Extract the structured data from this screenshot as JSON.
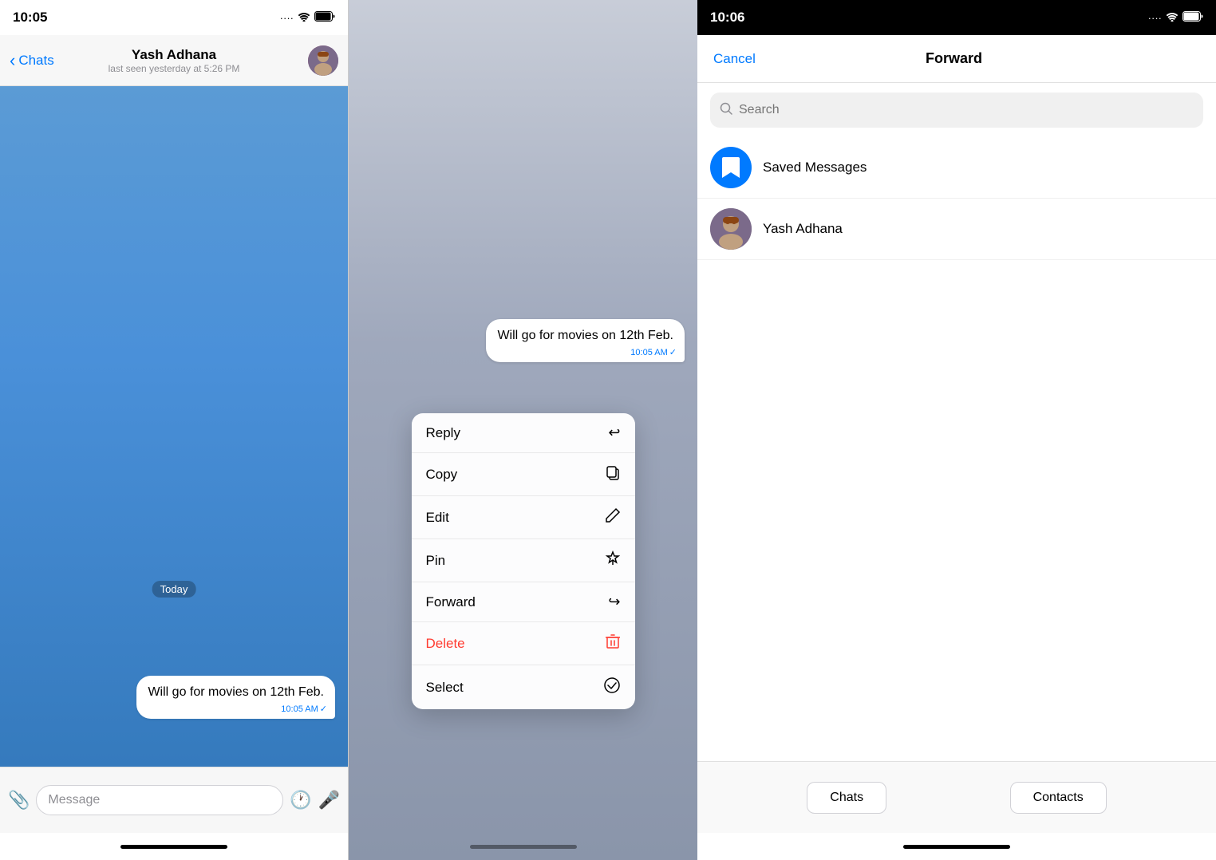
{
  "panel1": {
    "status_time": "10:05",
    "status_signal": "····",
    "status_wifi": "WiFi",
    "status_battery": "🔋",
    "nav_back": "Chats",
    "contact_name": "Yash Adhana",
    "contact_status": "last seen yesterday at 5:26 PM",
    "date_label": "Today",
    "message_text": "Will go for movies on 12th Feb.",
    "message_time": "10:05 AM",
    "input_placeholder": "Message",
    "home_bar": ""
  },
  "panel2": {
    "message_text": "Will go for movies on 12th Feb.",
    "message_time": "10:05 AM",
    "menu_items": [
      {
        "label": "Reply",
        "icon": "↩",
        "is_delete": false
      },
      {
        "label": "Copy",
        "icon": "⧉",
        "is_delete": false
      },
      {
        "label": "Edit",
        "icon": "✎",
        "is_delete": false
      },
      {
        "label": "Pin",
        "icon": "📌",
        "is_delete": false
      },
      {
        "label": "Forward",
        "icon": "↪",
        "is_delete": false
      },
      {
        "label": "Delete",
        "icon": "🗑",
        "is_delete": true
      },
      {
        "label": "Select",
        "icon": "✓",
        "is_delete": false
      }
    ]
  },
  "panel3": {
    "status_time": "10:06",
    "cancel_label": "Cancel",
    "title": "Forward",
    "search_placeholder": "Search",
    "contacts": [
      {
        "name": "Saved Messages",
        "type": "saved"
      },
      {
        "name": "Yash Adhana",
        "type": "user"
      }
    ],
    "tabs": [
      {
        "label": "Chats"
      },
      {
        "label": "Contacts"
      }
    ]
  }
}
